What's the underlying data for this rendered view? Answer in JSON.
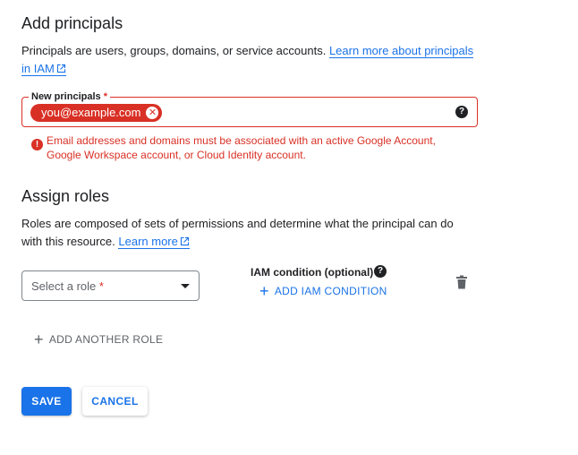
{
  "principals": {
    "title": "Add principals",
    "description": "Principals are users, groups, domains, or service accounts.",
    "learn_more_line1": "Learn more about principals",
    "learn_more_line2": "in IAM",
    "field_label": "New principals",
    "required_mark": "*",
    "chip_value": "you@example.com",
    "error_line1": "Email addresses and domains must be associated with an active Google Account,",
    "error_line2": "Google Workspace account, or Cloud Identity account."
  },
  "roles": {
    "title": "Assign roles",
    "description_line1": "Roles are composed of sets of permissions and determine what the principal can do",
    "description_line2": "with this resource.",
    "learn_more": "Learn more",
    "select_placeholder": "Select a role",
    "required_mark": "*",
    "iam_condition_label": "IAM condition (optional)",
    "add_iam_condition": "ADD IAM CONDITION",
    "add_another_role": "ADD ANOTHER ROLE"
  },
  "actions": {
    "save": "SAVE",
    "cancel": "CANCEL"
  },
  "colors": {
    "accent": "#1a73e8",
    "error": "#d93025",
    "text": "#202124"
  },
  "icons": [
    "external-link-icon",
    "help-icon",
    "error-icon",
    "remove-chip-icon",
    "dropdown-icon",
    "plus-icon",
    "delete-icon"
  ]
}
